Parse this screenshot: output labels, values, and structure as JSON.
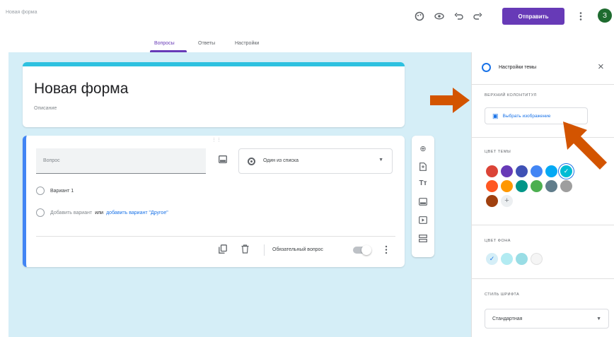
{
  "header": {
    "doc_title": "Новая форма",
    "send_label": "Отправить",
    "avatar_letter": "З",
    "icons": [
      "palette-icon",
      "preview-eye-icon",
      "undo-icon",
      "redo-icon",
      "more-vert-icon"
    ]
  },
  "tabs": [
    {
      "label": "Вопросы",
      "active": true
    },
    {
      "label": "Ответы",
      "active": false
    },
    {
      "label": "Настройки",
      "active": false
    }
  ],
  "form": {
    "title": "Новая форма",
    "description": "Описание"
  },
  "question": {
    "placeholder": "Вопрос",
    "type_label": "Один из списка",
    "option1": "Вариант 1",
    "add_option": "Добавить вариант",
    "or_text": "или",
    "add_other": "добавить вариант \"Другое\"",
    "required_label": "Обязательный вопрос"
  },
  "floating_toolbar": [
    "add-question-icon",
    "import-questions-icon",
    "add-title-icon",
    "add-image-icon",
    "add-video-icon",
    "add-section-icon"
  ],
  "theme_panel": {
    "title": "Настройки темы",
    "header_section_label": "ВЕРХНИЙ КОЛОНТИТУЛ",
    "choose_image_label": "Выбрать изображение",
    "theme_color_label": "ЦВЕТ ТЕМЫ",
    "theme_colors": [
      "#db4437",
      "#673ab7",
      "#3f51b5",
      "#4285f4",
      "#03a9f4",
      "#00bcd4",
      "#ff5722",
      "#ff9800",
      "#009688",
      "#4caf50",
      "#607d8b",
      "#9e9e9e",
      "#a0400f"
    ],
    "selected_theme_color": "#00bcd4",
    "bg_color_label": "ЦВЕТ ФОНА",
    "bg_colors": [
      "#d5eef7",
      "#b2ebf2",
      "#99dde5",
      "#f5f5f5"
    ],
    "selected_bg_color": "#d5eef7",
    "font_style_label": "СТИЛЬ ШРИФТА",
    "font_style_value": "Стандартная"
  },
  "annotation": {
    "arrow_color": "#d35400"
  }
}
